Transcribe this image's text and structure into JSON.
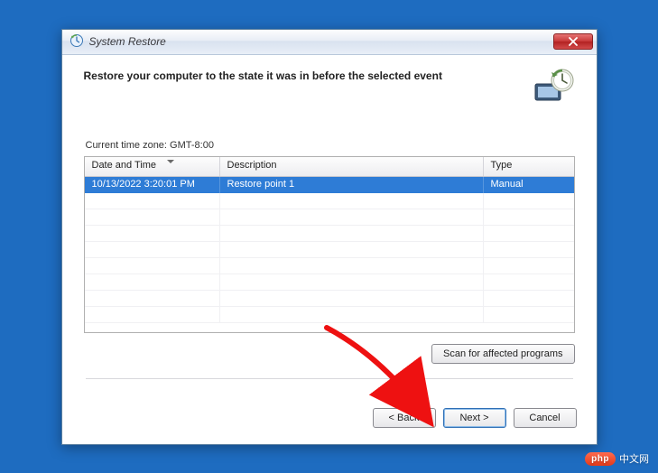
{
  "window": {
    "title": "System Restore"
  },
  "header": {
    "text": "Restore your computer to the state it was in before the selected event"
  },
  "timezone_label": "Current time zone: GMT-8:00",
  "table": {
    "columns": {
      "date": "Date and Time",
      "desc": "Description",
      "type": "Type"
    },
    "rows": [
      {
        "date": "10/13/2022 3:20:01 PM",
        "desc": "Restore point 1",
        "type": "Manual"
      }
    ]
  },
  "buttons": {
    "scan": "Scan for affected programs",
    "back": "< Back",
    "next": "Next >",
    "cancel": "Cancel"
  },
  "watermark": {
    "badge": "php",
    "text": "中文网"
  }
}
